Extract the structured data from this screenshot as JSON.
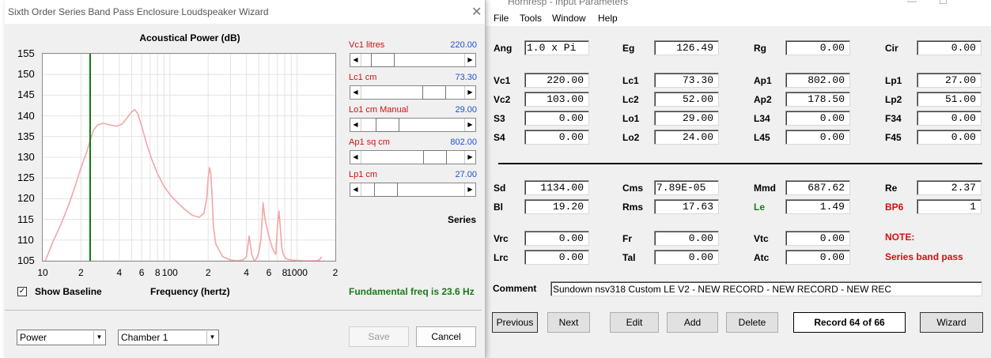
{
  "wizard": {
    "title": "Sixth Order Series Band Pass Enclosure Loudspeaker Wizard",
    "close_glyph": "✕",
    "chart_title": "Acoustical Power (dB)",
    "x_axis_label": "Frequency (hertz)",
    "show_baseline_label": "Show Baseline",
    "show_baseline_checked": true,
    "series_label": "Series",
    "fundamental_text": "Fundamental freq is 23.6 Hz",
    "sliders": [
      {
        "label": "Vc1  litres",
        "value": "220.00",
        "position": 0.12
      },
      {
        "label": "Lc1  cm",
        "value": "73.30",
        "position": 0.75
      },
      {
        "label": "Lo1  cm  Manual",
        "value": "29.00",
        "position": 0.18
      },
      {
        "label": "Ap1  sq cm",
        "value": "802.00",
        "position": 0.76
      },
      {
        "label": "Lp1  cm",
        "value": "27.00",
        "position": 0.16
      }
    ],
    "power_select": "Power",
    "chamber_select": "Chamber 1",
    "save_label": "Save",
    "cancel_label": "Cancel"
  },
  "chart_data": {
    "type": "line",
    "title": "Acoustical Power (dB)",
    "xlabel": "Frequency (hertz)",
    "ylabel": "",
    "xscale": "log",
    "xlim": [
      10,
      2000
    ],
    "ylim": [
      105,
      155
    ],
    "y_ticks": [
      155,
      150,
      145,
      140,
      135,
      130,
      125,
      120,
      115,
      110,
      105
    ],
    "x_ticks": [
      {
        "value": 10,
        "label": "10"
      },
      {
        "value": 20,
        "label": "2"
      },
      {
        "value": 40,
        "label": "4"
      },
      {
        "value": 60,
        "label": "6"
      },
      {
        "value": 80,
        "label": "8"
      },
      {
        "value": 100,
        "label": "100"
      },
      {
        "value": 200,
        "label": "2"
      },
      {
        "value": 400,
        "label": "4"
      },
      {
        "value": 600,
        "label": "6"
      },
      {
        "value": 800,
        "label": "8"
      },
      {
        "value": 1000,
        "label": "1000"
      },
      {
        "value": 2000,
        "label": "2"
      }
    ],
    "grid": true,
    "marker_line_x": 23.6,
    "series": [
      {
        "color": "#f2a6a6",
        "x": [
          10.5,
          12,
          14,
          16,
          18,
          20,
          22,
          23.6,
          25,
          27,
          30,
          34,
          38,
          42,
          46,
          50,
          53,
          56,
          60,
          66,
          72,
          80,
          90,
          100,
          115,
          130,
          150,
          170,
          185,
          195,
          200,
          205,
          210,
          215,
          220,
          230,
          260,
          300,
          340,
          380,
          400,
          420,
          440,
          460,
          480,
          500,
          520,
          540,
          560,
          600,
          640,
          680,
          700,
          720,
          740,
          760,
          780,
          820,
          900,
          1000,
          1100,
          1200,
          1300,
          1400,
          1500,
          1560
        ],
        "y": [
          105,
          109.5,
          114,
          118.5,
          123,
          127.5,
          131,
          134,
          136.5,
          137.8,
          138.2,
          137.8,
          137.5,
          138,
          139.5,
          141,
          141.5,
          140.5,
          137.5,
          133,
          129.5,
          126,
          123,
          121,
          119,
          117.5,
          116,
          115.5,
          116.5,
          120,
          125,
          127.5,
          126,
          120,
          113,
          109,
          106,
          105.2,
          105,
          105.3,
          106,
          111,
          106.5,
          105,
          105.5,
          107,
          110,
          119,
          115,
          111,
          108,
          106.5,
          113,
          117,
          112.5,
          108,
          106.5,
          105.5,
          105.2,
          105.1,
          105,
          105,
          105,
          105,
          105.2,
          106
        ]
      }
    ]
  },
  "hornresp": {
    "title": "Hornresp - Input Parameters",
    "menu": [
      "File",
      "Tools",
      "Window",
      "Help"
    ],
    "params": [
      {
        "label": "Ang",
        "value": "1.0 x Pi",
        "row": 0,
        "col": 0,
        "align": "left"
      },
      {
        "label": "Eg",
        "value": "126.49",
        "row": 0,
        "col": 1
      },
      {
        "label": "Rg",
        "value": "0.00",
        "row": 0,
        "col": 2
      },
      {
        "label": "Cir",
        "value": "0.00",
        "row": 0,
        "col": 3
      },
      {
        "label": "Vc1",
        "value": "220.00",
        "row": 1,
        "col": 0
      },
      {
        "label": "Lc1",
        "value": "73.30",
        "row": 1,
        "col": 1
      },
      {
        "label": "Ap1",
        "value": "802.00",
        "row": 1,
        "col": 2
      },
      {
        "label": "Lp1",
        "value": "27.00",
        "row": 1,
        "col": 3
      },
      {
        "label": "Vc2",
        "value": "103.00",
        "row": 2,
        "col": 0
      },
      {
        "label": "Lc2",
        "value": "52.00",
        "row": 2,
        "col": 1
      },
      {
        "label": "Ap2",
        "value": "178.50",
        "row": 2,
        "col": 2
      },
      {
        "label": "Lp2",
        "value": "51.00",
        "row": 2,
        "col": 3
      },
      {
        "label": "S3",
        "value": "0.00",
        "row": 3,
        "col": 0
      },
      {
        "label": "Lo1",
        "value": "29.00",
        "row": 3,
        "col": 1
      },
      {
        "label": "L34",
        "value": "0.00",
        "row": 3,
        "col": 2
      },
      {
        "label": "F34",
        "value": "0.00",
        "row": 3,
        "col": 3
      },
      {
        "label": "S4",
        "value": "0.00",
        "row": 4,
        "col": 0
      },
      {
        "label": "Lo2",
        "value": "24.00",
        "row": 4,
        "col": 1
      },
      {
        "label": "L45",
        "value": "0.00",
        "row": 4,
        "col": 2
      },
      {
        "label": "F45",
        "value": "0.00",
        "row": 4,
        "col": 3
      },
      {
        "label": "Sd",
        "value": "1134.00",
        "row": 5,
        "col": 0
      },
      {
        "label": "Cms",
        "value": "7.89E-05",
        "row": 5,
        "col": 1,
        "align": "left"
      },
      {
        "label": "Mmd",
        "value": "687.62",
        "row": 5,
        "col": 2
      },
      {
        "label": "Re",
        "value": "2.37",
        "row": 5,
        "col": 3
      },
      {
        "label": "Bl",
        "value": "19.20",
        "row": 6,
        "col": 0
      },
      {
        "label": "Rms",
        "value": "17.63",
        "row": 6,
        "col": 1
      },
      {
        "label": "Le",
        "value": "1.49",
        "row": 6,
        "col": 2,
        "label_color": "#1a7a1a"
      },
      {
        "label": "BP6",
        "value": "1",
        "row": 6,
        "col": 3,
        "label_color": "#d01010"
      },
      {
        "label": "Vrc",
        "value": "0.00",
        "row": 7,
        "col": 0
      },
      {
        "label": "Fr",
        "value": "0.00",
        "row": 7,
        "col": 1
      },
      {
        "label": "Vtc",
        "value": "0.00",
        "row": 7,
        "col": 2
      },
      {
        "label": "Lrc",
        "value": "0.00",
        "row": 8,
        "col": 0
      },
      {
        "label": "Tal",
        "value": "0.00",
        "row": 8,
        "col": 1
      },
      {
        "label": "Atc",
        "value": "0.00",
        "row": 8,
        "col": 2
      }
    ],
    "note_label": "NOTE:",
    "note_text": "Series band pass",
    "comment_label": "Comment",
    "comment_value": "Sundown nsv318 Custom LE V2 - NEW RECORD - NEW RECORD - NEW REC",
    "buttons": {
      "previous": "Previous",
      "next": "Next",
      "edit": "Edit",
      "add": "Add",
      "delete": "Delete",
      "record": "Record 64 of 66",
      "wizard": "Wizard"
    }
  }
}
